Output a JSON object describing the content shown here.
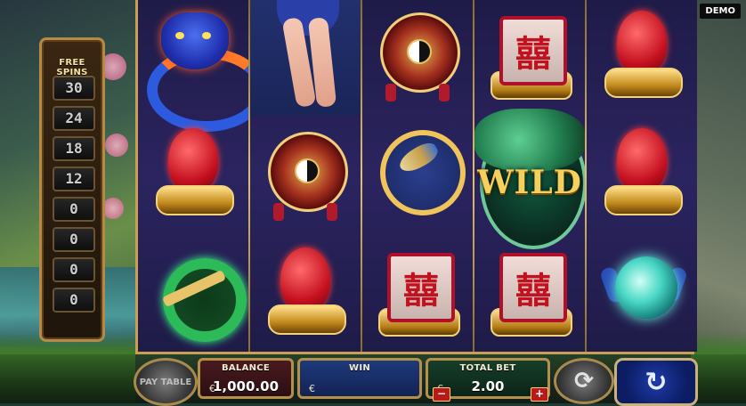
{
  "badge": {
    "demo": "DEMO"
  },
  "free_spins": {
    "title": "FREE SPINS",
    "slots": [
      "30",
      "24",
      "18",
      "12",
      "0",
      "0",
      "0",
      "0"
    ]
  },
  "reels": [
    {
      "symbols": [
        "dragon",
        "egg",
        "jade-ring"
      ]
    },
    {
      "symbols": [
        "dancer",
        "medallion",
        "egg"
      ]
    },
    {
      "symbols": [
        "medallion",
        "koi",
        "double-happiness"
      ]
    },
    {
      "symbols": [
        "double-happiness",
        "wild",
        "double-happiness"
      ]
    },
    {
      "symbols": [
        "egg",
        "egg",
        "crystal-orb"
      ]
    }
  ],
  "wild_label": "WILD",
  "double_happiness_char": "囍",
  "controls": {
    "paytable": "PAY TABLE",
    "balance_label": "BALANCE",
    "balance_currency": "€",
    "balance_value": "1,000.00",
    "win_label": "WIN",
    "win_currency": "€",
    "win_value": "",
    "bet_label": "TOTAL BET",
    "bet_currency": "€",
    "bet_value": "2.00",
    "minus": "−",
    "plus": "+",
    "spin_icon": "↻",
    "autoplay_icon": "⟳"
  },
  "colors": {
    "frame_gold": "#c9a052",
    "reel_bg": "#2b2460",
    "wild_gold": "#f4d05d"
  }
}
